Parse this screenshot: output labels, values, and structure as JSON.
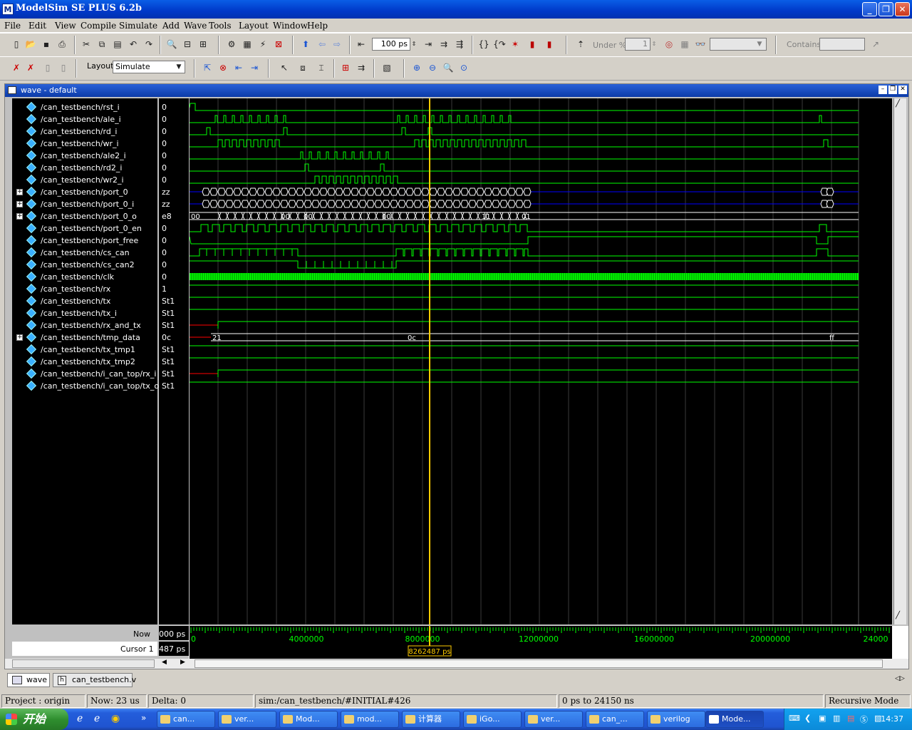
{
  "window": {
    "title": "ModelSim SE PLUS 6.2b",
    "icon_letter": "M"
  },
  "menu": [
    "File",
    "Edit",
    "View",
    "Compile",
    "Simulate",
    "Add",
    "Wave",
    "Tools",
    "Layout",
    "Window",
    "Help"
  ],
  "toolbar1": {
    "run_length": "100 ps",
    "under_label": "Under %",
    "under_value": "1",
    "contains_label": "Contains"
  },
  "toolbar2": {
    "layout_label": "Layout",
    "layout_value": "Simulate"
  },
  "wave_window": {
    "title": "wave - default"
  },
  "signals": [
    {
      "name": "/can_testbench/rst_i",
      "value": "0",
      "bus": false
    },
    {
      "name": "/can_testbench/ale_i",
      "value": "0",
      "bus": false
    },
    {
      "name": "/can_testbench/rd_i",
      "value": "0",
      "bus": false
    },
    {
      "name": "/can_testbench/wr_i",
      "value": "0",
      "bus": false
    },
    {
      "name": "/can_testbench/ale2_i",
      "value": "0",
      "bus": false
    },
    {
      "name": "/can_testbench/rd2_i",
      "value": "0",
      "bus": false
    },
    {
      "name": "/can_testbench/wr2_i",
      "value": "0",
      "bus": false
    },
    {
      "name": "/can_testbench/port_0",
      "value": "zz",
      "bus": true
    },
    {
      "name": "/can_testbench/port_0_i",
      "value": "zz",
      "bus": true
    },
    {
      "name": "/can_testbench/port_0_o",
      "value": "e8",
      "bus": true
    },
    {
      "name": "/can_testbench/port_0_en",
      "value": "0",
      "bus": false
    },
    {
      "name": "/can_testbench/port_free",
      "value": "0",
      "bus": false
    },
    {
      "name": "/can_testbench/cs_can",
      "value": "0",
      "bus": false
    },
    {
      "name": "/can_testbench/cs_can2",
      "value": "0",
      "bus": false
    },
    {
      "name": "/can_testbench/clk",
      "value": "0",
      "bus": false
    },
    {
      "name": "/can_testbench/rx",
      "value": "1",
      "bus": false
    },
    {
      "name": "/can_testbench/tx",
      "value": "St1",
      "bus": false
    },
    {
      "name": "/can_testbench/tx_i",
      "value": "St1",
      "bus": false
    },
    {
      "name": "/can_testbench/rx_and_tx",
      "value": "St1",
      "bus": false
    },
    {
      "name": "/can_testbench/tmp_data",
      "value": "0c",
      "bus": true
    },
    {
      "name": "/can_testbench/tx_tmp1",
      "value": "St1",
      "bus": false
    },
    {
      "name": "/can_testbench/tx_tmp2",
      "value": "St1",
      "bus": false
    },
    {
      "name": "/can_testbench/i_can_top/rx_i",
      "value": "St1",
      "bus": false
    },
    {
      "name": "/can_testbench/i_can_top/tx_o",
      "value": "St1",
      "bus": false
    }
  ],
  "bus_labels": {
    "port_0_o": [
      "00",
      "00",
      "00",
      "00",
      "11",
      "01"
    ],
    "tmp_data": [
      "21",
      "0c",
      "ff"
    ]
  },
  "timeline": {
    "ticks": [
      "0",
      "4000000",
      "8000000",
      "12000000",
      "16000000",
      "20000000",
      "24000"
    ],
    "cursor_label": "8262487 ps"
  },
  "cursor_panel": {
    "now_label": "Now",
    "now_value": "000 ps",
    "cursor_label": "Cursor 1",
    "cursor_value": "487 ps"
  },
  "bottom_tabs": [
    "wave",
    "can_testbench.v"
  ],
  "status": {
    "project": "Project : origin",
    "now": "Now: 23 us",
    "delta": "Delta: 0",
    "path": "sim:/can_testbench/#INITIAL#426",
    "range": "0 ps to 24150 ns",
    "mode": "Recursive Mode"
  },
  "taskbar": {
    "start": "开始",
    "tasks": [
      "can...",
      "ver...",
      "Mod...",
      "mod...",
      "计算器",
      "iGo...",
      "ver...",
      "can_...",
      "verilog",
      "Mode..."
    ],
    "clock": "14:37"
  },
  "colors": {
    "wave_green": "#00ff00",
    "cursor_yellow": "#ffcc00",
    "bus_blue": "#0000ff",
    "error_red": "#ff0000"
  }
}
